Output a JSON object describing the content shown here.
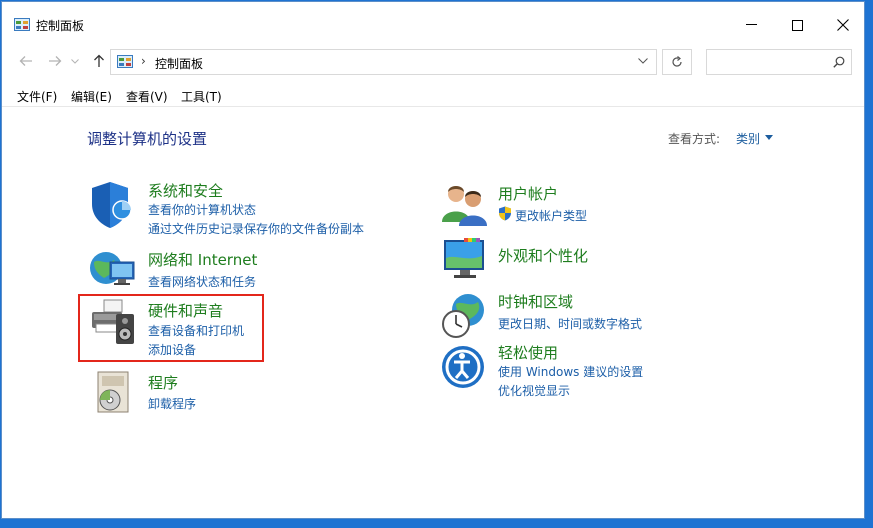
{
  "window": {
    "title": "控制面板"
  },
  "address": {
    "path": "控制面板",
    "separator": "›"
  },
  "search": {
    "placeholder": ""
  },
  "menu": {
    "file": "文件(F)",
    "edit": "编辑(E)",
    "view": "查看(V)",
    "tools": "工具(T)"
  },
  "main": {
    "heading": "调整计算机的设置",
    "view_by_label": "查看方式:",
    "view_by_value": "类别"
  },
  "categories": {
    "system": {
      "title": "系统和安全",
      "links": [
        "查看你的计算机状态",
        "通过文件历史记录保存你的文件备份副本"
      ]
    },
    "network": {
      "title": "网络和 Internet",
      "links": [
        "查看网络状态和任务"
      ]
    },
    "hardware": {
      "title": "硬件和声音",
      "links": [
        "查看设备和打印机",
        "添加设备"
      ]
    },
    "programs": {
      "title": "程序",
      "links": [
        "卸载程序"
      ]
    },
    "user": {
      "title": "用户帐户",
      "links": [
        "更改帐户类型"
      ]
    },
    "appearance": {
      "title": "外观和个性化",
      "links": []
    },
    "clock": {
      "title": "时钟和区域",
      "links": [
        "更改日期、时间或数字格式"
      ]
    },
    "ease": {
      "title": "轻松使用",
      "links": [
        "使用 Windows 建议的设置",
        "优化视觉显示"
      ]
    }
  },
  "colors": {
    "accent": "#1e73d2",
    "category_title": "#1e7d1e",
    "link": "#1d5fa8",
    "highlight": "#e3261b"
  }
}
